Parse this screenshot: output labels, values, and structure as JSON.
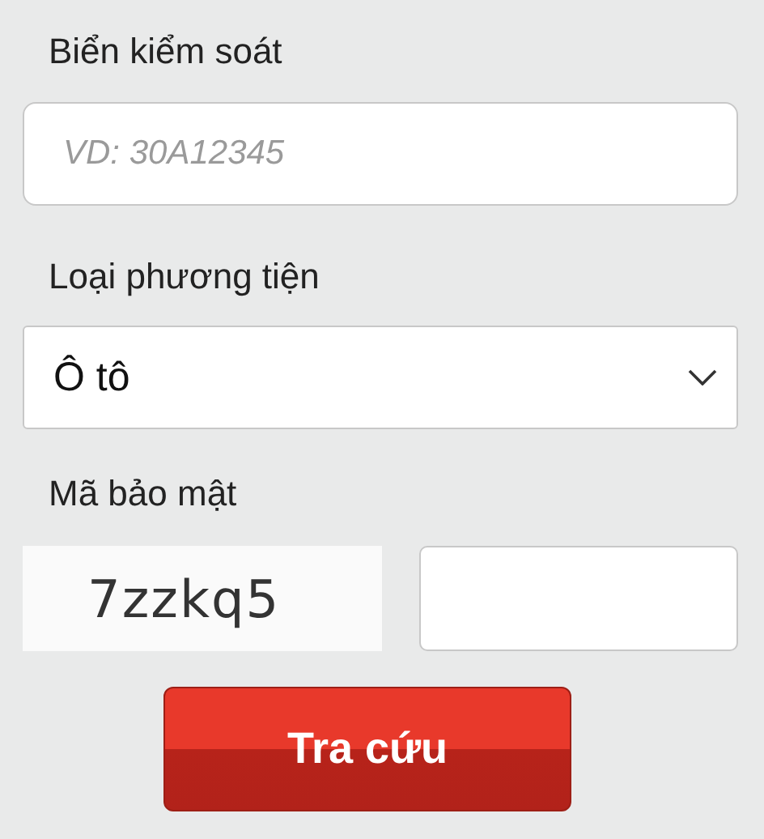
{
  "plate": {
    "label": "Biển kiểm soát",
    "placeholder": "VD: 30A12345"
  },
  "vehicle_type": {
    "label": "Loại phương tiện",
    "value": "Ô tô"
  },
  "security_code": {
    "label": "Mã bảo mật",
    "captcha": "7zzkq5"
  },
  "submit": {
    "label": "Tra cứu"
  }
}
